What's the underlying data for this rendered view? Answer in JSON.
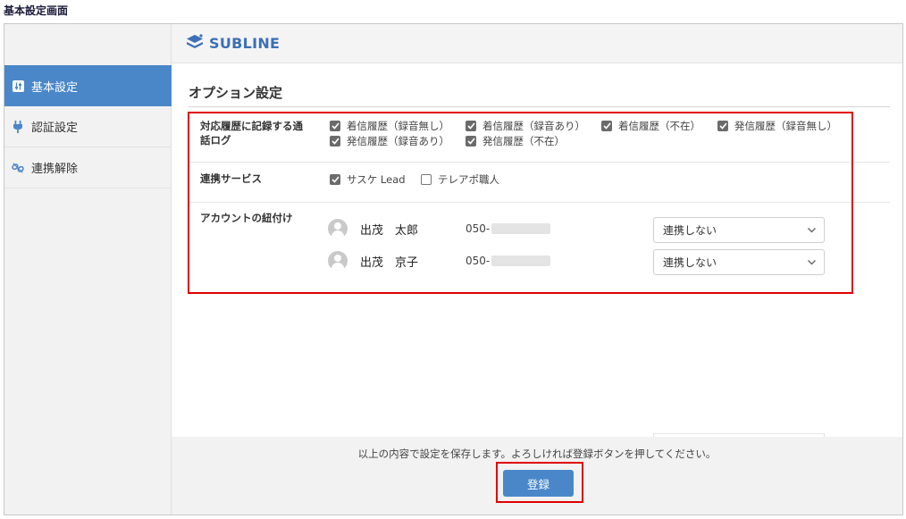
{
  "page_caption": "基本設定画面",
  "header": {
    "logo_text": "SUBLINE"
  },
  "sidebar": {
    "items": [
      {
        "label": "基本設定",
        "icon": "sliders-icon",
        "active": true
      },
      {
        "label": "認証設定",
        "icon": "plug-icon",
        "active": false
      },
      {
        "label": "連携解除",
        "icon": "unlink-icon",
        "active": false
      }
    ]
  },
  "main": {
    "title": "オプション設定",
    "call_history": {
      "label_line1": "対応履歴に記録する通",
      "label_line2": "話ログ",
      "options": [
        {
          "label": "着信履歴（録音無し）",
          "checked": true
        },
        {
          "label": "着信履歴（録音あり）",
          "checked": true
        },
        {
          "label": "着信履歴（不在）",
          "checked": true
        },
        {
          "label": "発信履歴（録音無し）",
          "checked": true
        },
        {
          "label": "発信履歴（録音あり）",
          "checked": true
        },
        {
          "label": "発信履歴（不在）",
          "checked": true
        }
      ]
    },
    "services": {
      "label": "連携サービス",
      "options": [
        {
          "label": "サスケ Lead",
          "checked": true
        },
        {
          "label": "テレアポ職人",
          "checked": false
        }
      ]
    },
    "accounts": {
      "label": "アカウントの紐付け",
      "rows": [
        {
          "name": "出茂　太郎",
          "tel_prefix": "050-",
          "select_value": "連携しない"
        },
        {
          "name": "出茂　京子",
          "tel_prefix": "050-",
          "select_value": "連携しない"
        }
      ]
    }
  },
  "footer": {
    "message": "以上の内容で設定を保存します。よろしければ登録ボタンを押してください。",
    "save_label": "登録"
  },
  "colors": {
    "accent": "#4a87c8",
    "highlight": "#e00000",
    "logo": "#3c6fb6"
  }
}
